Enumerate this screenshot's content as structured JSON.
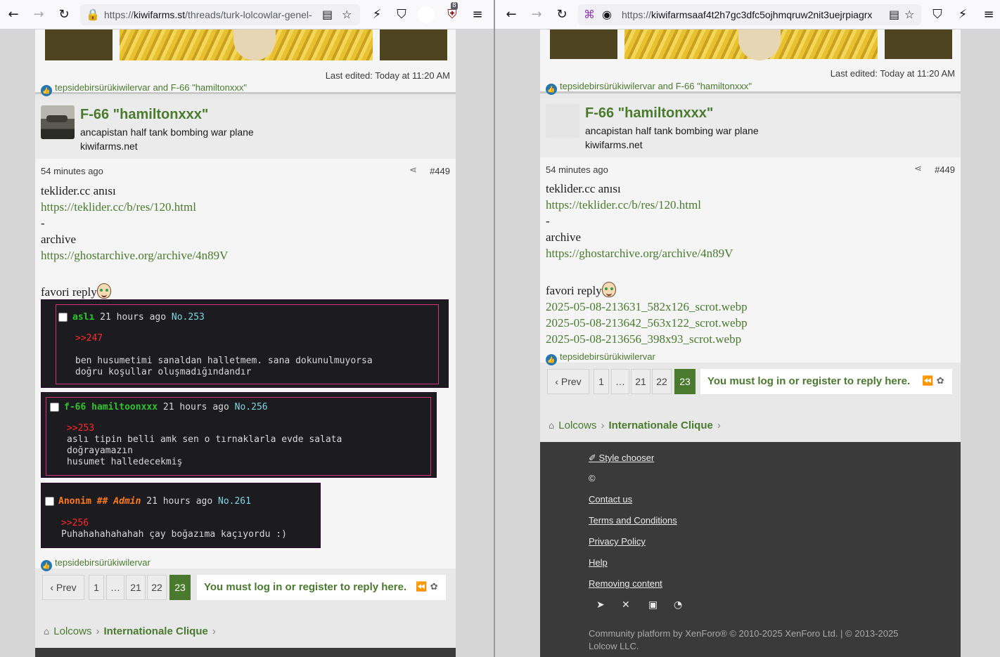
{
  "left_window": {
    "url": {
      "host": "kiwifarms.st",
      "prefix": "https://",
      "path": "/threads/turk-lolcowlar-genel-"
    },
    "ublock_count": "8"
  },
  "right_window": {
    "url": {
      "host": "kiwifarmsaaf4t2h7gc3dfc5ojhmqruw2nit3uejrpiagrx",
      "prefix": "https://",
      "path": ""
    }
  },
  "prev_post": {
    "edited": "Last edited: Today at 11:20 AM",
    "reactions": "tepsidebirsürükiwilervar and F-66 \"hamiltonxxx\""
  },
  "post": {
    "username": "F-66 \"hamiltonxxx\"",
    "user_title": "ancapistan half tank bombing war plane",
    "user_banner": "kiwifarms.net",
    "time": "54 minutes ago",
    "number": "#449",
    "lines": [
      "teklider.cc anısı",
      "https://teklider.cc/b/res/120.html",
      "-",
      "archive",
      "https://ghostarchive.org/archive/4n89V"
    ],
    "favori": "favori reply",
    "attachments": [
      "2025-05-08-213631_582x126_scrot.webp",
      "2025-05-08-213642_563x122_scrot.webp",
      "2025-05-08-213656_398x93_scrot.webp"
    ],
    "reaction": "tepsidebirsürükiwilervar"
  },
  "imageboard": [
    {
      "name": "aslı",
      "time": "21 hours ago",
      "no": "No.253",
      "quote": ">>247",
      "text": [
        "ben husumetimi sanaldan halletmem. sana dokunulmuyorsa",
        "doğru koşullar oluşmadığındandır"
      ]
    },
    {
      "name": "f-66 hamiltoonxxx",
      "time": "21 hours ago",
      "no": "No.256",
      "quote": ">>253",
      "text": [
        "aslı tipin belli amk sen o tırnaklarla evde salata",
        "doğrayamazın",
        "husumet halledecekmiş"
      ]
    },
    {
      "name": "Anonim",
      "admin": "## Admin",
      "time": "21 hours ago",
      "no": "No.261",
      "quote": ">>256",
      "text": [
        "Puhahahahahahah çay boğazıma kaçıyordu :)"
      ]
    }
  ],
  "pagination": {
    "prev": "Prev",
    "pages": [
      "1",
      "…",
      "21",
      "22",
      "23"
    ],
    "current": "23",
    "must_login": "You must log in or register to reply here."
  },
  "breadcrumb": {
    "root": "Lolcows",
    "current": "Internationale Clique"
  },
  "footer": {
    "links": [
      "Style chooser",
      "Contact us",
      "Terms and Conditions",
      "Privacy Policy",
      "Help",
      "Removing content"
    ],
    "icons": [
      "telegram-icon",
      "x-icon",
      "linkedin-icon",
      "rss-icon"
    ],
    "copyright": "Community platform by XenForo® © 2010-2025 XenForo Ltd. | © 2013-2025 Lolcow LLC."
  }
}
